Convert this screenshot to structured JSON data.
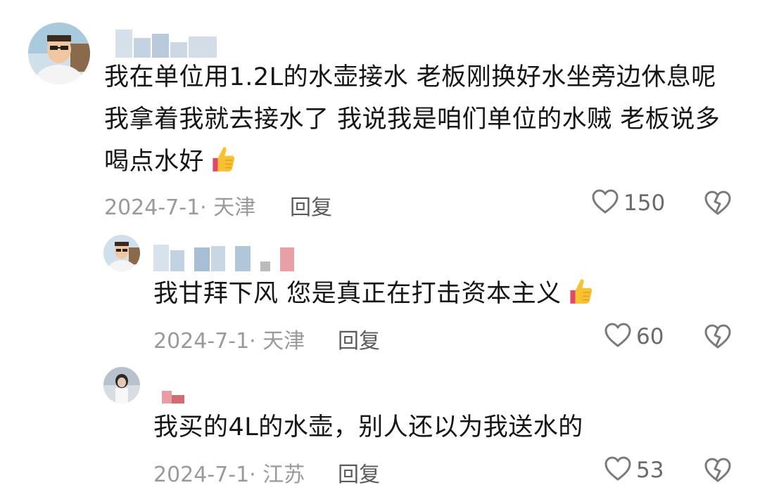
{
  "comments": [
    {
      "text_lines": [
        "我在单位用1.2L的水壶接水 老板刚换好水坐旁边休息呢",
        "我拿着我就去接水了 我说我是咱们单位的水贼 老板说多",
        "喝点水好"
      ],
      "emoji": "thumbs-up",
      "date_location": "2024-7-1· 天津",
      "reply_label": "回复",
      "likes": "150"
    },
    {
      "text_lines": [
        "我甘拜下风 您是真正在打击资本主义"
      ],
      "emoji": "thumbs-up",
      "date_location": "2024-7-1· 天津",
      "reply_label": "回复",
      "likes": "60"
    },
    {
      "text_lines": [
        "我买的4L的水壶，别人还以为我送水的"
      ],
      "date_location": "2024-7-1· 江苏",
      "reply_label": "回复",
      "likes": "53"
    }
  ],
  "colors": {
    "text": "#161616",
    "meta": "#9a9a9a",
    "reply": "#5b5b5b",
    "icon": "#7a7a7a"
  },
  "icons": {
    "like": "heart-outline-icon",
    "dislike": "broken-heart-icon",
    "emoji": "thumbs-up-emoji-icon"
  }
}
